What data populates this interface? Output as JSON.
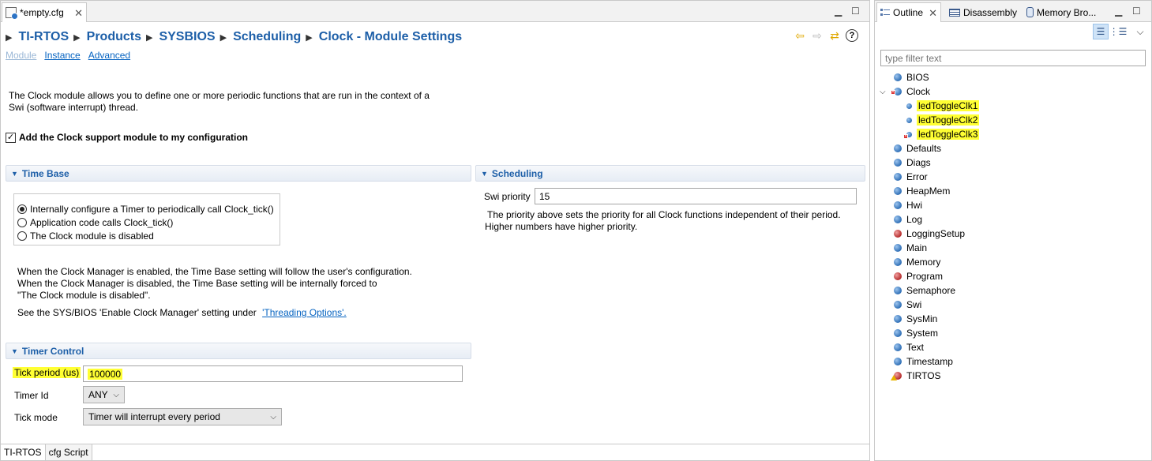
{
  "editor": {
    "tab_title": "*empty.cfg",
    "breadcrumb": [
      "TI-RTOS",
      "Products",
      "SYSBIOS",
      "Scheduling",
      "Clock - Module Settings"
    ],
    "subtabs": [
      "Module",
      "Instance",
      "Advanced"
    ],
    "description": "The Clock module allows you to define one or more periodic functions that are run in the context of a Swi (software interrupt) thread.",
    "add_module_label": "Add the Clock support module to my configuration",
    "add_module_checked": true,
    "time_base": {
      "title": "Time Base",
      "options": [
        "Internally configure a Timer to periodically call Clock_tick()",
        "Application code calls Clock_tick()",
        "The Clock module is disabled"
      ],
      "selected_index": 0,
      "note_lines": [
        "When the Clock Manager is enabled, the Time Base setting will follow the user's configuration.",
        "When the Clock Manager is disabled, the Time Base setting will be internally forced to",
        "\"The Clock module is disabled\"."
      ],
      "see_text": "See the SYS/BIOS 'Enable Clock Manager' setting under",
      "see_link": "'Threading Options'."
    },
    "timer_control": {
      "title": "Timer Control",
      "tick_period_label": "Tick period (us)",
      "tick_period_value": "100000",
      "timer_id_label": "Timer Id",
      "timer_id_value": "ANY",
      "tick_mode_label": "Tick mode",
      "tick_mode_value": "Timer will interrupt every period"
    },
    "scheduling": {
      "title": "Scheduling",
      "swi_priority_label": "Swi priority",
      "swi_priority_value": "15",
      "note_line1": "The priority above sets the priority for all Clock functions independent of their period.",
      "note_line2": "Higher numbers have higher priority."
    },
    "bottom_tabs": [
      "TI-RTOS",
      "cfg Script"
    ],
    "bottom_tab_active": 0
  },
  "outline": {
    "tabs": [
      "Outline",
      "Disassembly",
      "Memory Bro..."
    ],
    "filter_placeholder": "type filter text",
    "tree": [
      {
        "label": "BIOS",
        "color": "blue"
      },
      {
        "label": "Clock",
        "color": "blue",
        "expanded": true,
        "badge": "error"
      },
      {
        "label": "ledToggleClk1",
        "color": "blue",
        "child": true,
        "highlight": true
      },
      {
        "label": "ledToggleClk2",
        "color": "blue",
        "child": true,
        "highlight": true
      },
      {
        "label": "ledToggleClk3",
        "color": "blue",
        "child": true,
        "highlight": true,
        "badge": "error"
      },
      {
        "label": "Defaults",
        "color": "blue"
      },
      {
        "label": "Diags",
        "color": "blue"
      },
      {
        "label": "Error",
        "color": "blue"
      },
      {
        "label": "HeapMem",
        "color": "blue"
      },
      {
        "label": "Hwi",
        "color": "blue"
      },
      {
        "label": "Log",
        "color": "blue"
      },
      {
        "label": "LoggingSetup",
        "color": "red"
      },
      {
        "label": "Main",
        "color": "blue"
      },
      {
        "label": "Memory",
        "color": "blue"
      },
      {
        "label": "Program",
        "color": "red"
      },
      {
        "label": "Semaphore",
        "color": "blue"
      },
      {
        "label": "Swi",
        "color": "blue"
      },
      {
        "label": "SysMin",
        "color": "blue"
      },
      {
        "label": "System",
        "color": "blue"
      },
      {
        "label": "Text",
        "color": "blue"
      },
      {
        "label": "Timestamp",
        "color": "blue"
      },
      {
        "label": "TIRTOS",
        "color": "red",
        "badge": "warning"
      }
    ]
  },
  "colors": {
    "accent": "#1d5fa8",
    "highlight": "#ffff33",
    "link": "#0563c1"
  }
}
